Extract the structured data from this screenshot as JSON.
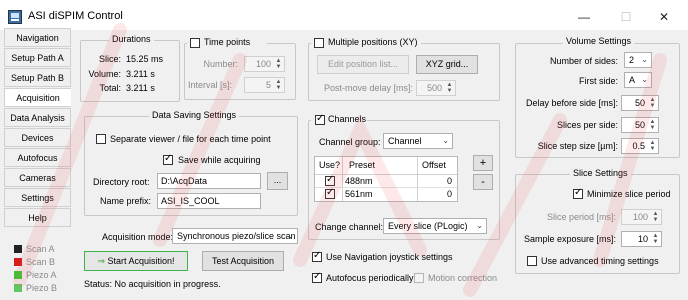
{
  "window": {
    "title": "ASI diSPIM Control",
    "minimize_glyph": "—",
    "maximize_glyph": "☐",
    "close_glyph": "✕"
  },
  "tabs": [
    {
      "label": "Navigation",
      "active": false
    },
    {
      "label": "Setup Path A",
      "active": false
    },
    {
      "label": "Setup Path B",
      "active": false
    },
    {
      "label": "Acquisition",
      "active": true
    },
    {
      "label": "Data Analysis",
      "active": false
    },
    {
      "label": "Devices",
      "active": false
    },
    {
      "label": "Autofocus",
      "active": false
    },
    {
      "label": "Cameras",
      "active": false
    },
    {
      "label": "Settings",
      "active": false
    },
    {
      "label": "Help",
      "active": false
    }
  ],
  "status_legend": [
    {
      "label": "Scan A",
      "color": "#222222"
    },
    {
      "label": "Scan B",
      "color": "#d81b1b"
    },
    {
      "label": "Piezo A",
      "color": "#38c838"
    },
    {
      "label": "Piezo B",
      "color": "#60c860"
    }
  ],
  "durations": {
    "title": "Durations",
    "slice_label": "Slice:",
    "slice_value": "15.25 ms",
    "volume_label": "Volume:",
    "volume_value": "3.211 s",
    "total_label": "Total:",
    "total_value": "3.211 s"
  },
  "time_points": {
    "title": "Time points",
    "number_label": "Number:",
    "number_value": "100",
    "interval_label": "Interval [s]:",
    "interval_value": "5"
  },
  "multiple_positions": {
    "title": "Multiple positions (XY)",
    "edit_button": "Edit position list...",
    "xyz_button": "XYZ grid...",
    "delay_label": "Post-move delay [ms]:",
    "delay_value": "500"
  },
  "data_saving": {
    "title": "Data Saving Settings",
    "separate_viewer_label": "Separate viewer / file for each time point",
    "save_while_acquiring_label": "Save while acquiring",
    "directory_root_label": "Directory root:",
    "directory_root_value": "D:\\AcqData",
    "browse_label": "...",
    "name_prefix_label": "Name prefix:",
    "name_prefix_value": "ASI_IS_COOL"
  },
  "acquisition_mode": {
    "label": "Acquisition mode:",
    "value": "Synchronous piezo/slice scan"
  },
  "buttons": {
    "start_icon": "⇒",
    "start_label": "Start Acquisition!",
    "test_label": "Test Acquisition"
  },
  "status_text": "Status: No acquisition in progress.",
  "channels": {
    "title": "Channels",
    "group_label": "Channel group:",
    "group_value": "Channel",
    "col_use": "Use?",
    "col_preset": "Preset",
    "col_offset": "Offset",
    "rows": [
      {
        "use": true,
        "preset": "488nm",
        "offset": "0"
      },
      {
        "use": true,
        "preset": "561nm",
        "offset": "0"
      }
    ],
    "add_label": "+",
    "remove_label": "-",
    "change_label": "Change channel:",
    "change_value": "Every slice (PLogic)"
  },
  "bottom_options": {
    "joystick_label": "Use Navigation joystick settings",
    "autofocus_label": "Autofocus periodically",
    "motion_label": "Motion correction"
  },
  "volume_settings": {
    "title": "Volume Settings",
    "sides_label": "Number of sides:",
    "sides_value": "2",
    "first_side_label": "First side:",
    "first_side_value": "A",
    "delay_label": "Delay before side [ms]:",
    "delay_value": "50",
    "slices_label": "Slices per side:",
    "slices_value": "50",
    "step_label": "Slice step size [µm]:",
    "step_value": "0.5"
  },
  "slice_settings": {
    "title": "Slice Settings",
    "minimize_label": "Minimize slice period",
    "period_label": "Slice period [ms]:",
    "period_value": "100",
    "exposure_label": "Sample exposure [ms]:",
    "exposure_value": "10",
    "advanced_label": "Use advanced timing settings"
  }
}
